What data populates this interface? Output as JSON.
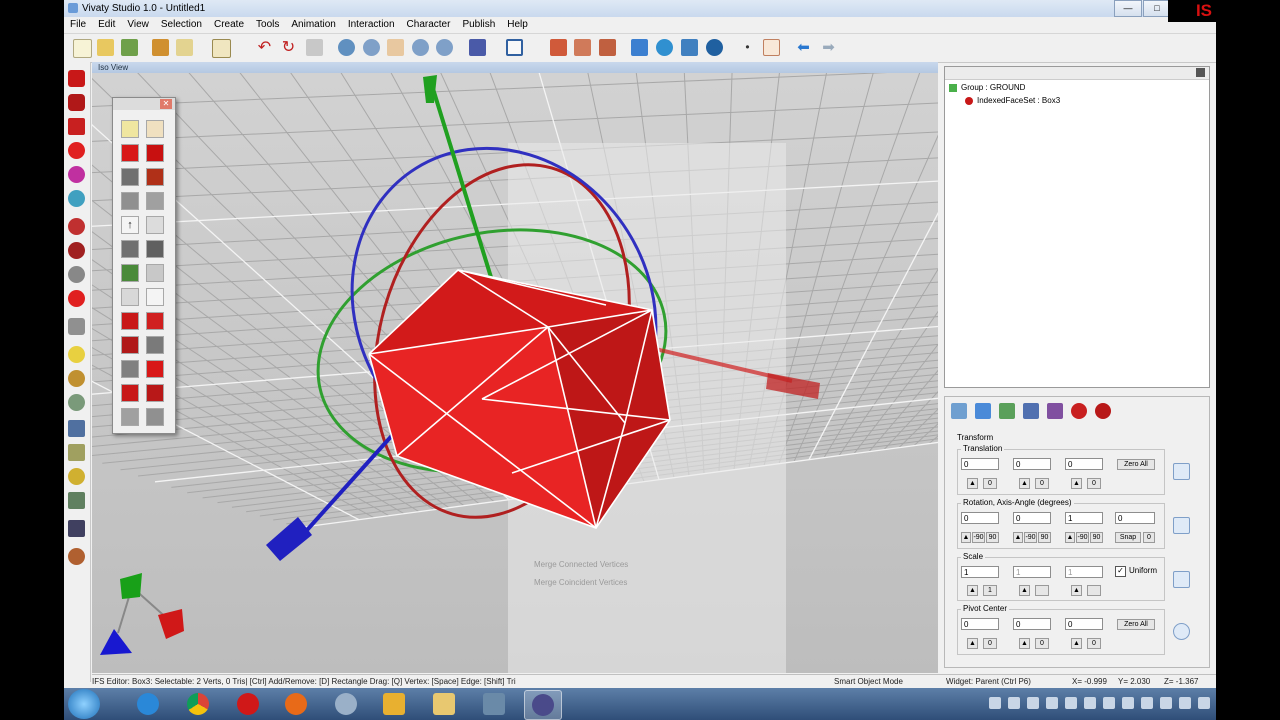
{
  "window": {
    "title": "Vivaty Studio 1.0 - Untitled1",
    "minimize": "—",
    "maximize": "□",
    "close": "✕"
  },
  "corner_badge": "IS",
  "menu": [
    "File",
    "Edit",
    "View",
    "Selection",
    "Create",
    "Tools",
    "Animation",
    "Interaction",
    "Character",
    "Publish",
    "Help"
  ],
  "viewport": {
    "title": "Iso View"
  },
  "scene_tree": {
    "group": "Group : GROUND",
    "child": "IndexedFaceSet : Box3"
  },
  "properties": {
    "transform_label": "Transform",
    "translation": {
      "label": "Translation",
      "x": "0",
      "y": "0",
      "z": "0",
      "zero_all": "Zero All",
      "step": "0"
    },
    "rotation": {
      "label": "Rotation, Axis-Angle (degrees)",
      "x": "0",
      "y": "0",
      "z": "1",
      "angle": "0",
      "neg90": "-90",
      "pos90": "90",
      "snap": "Snap",
      "snap_val": "0"
    },
    "scale": {
      "label": "Scale",
      "x": "1",
      "y": "1",
      "z": "1",
      "uniform": "Uniform",
      "uniform_checked": true,
      "step": "1"
    },
    "pivot": {
      "label": "Pivot Center",
      "x": "0",
      "y": "0",
      "z": "0",
      "zero_all": "Zero All",
      "step": "0"
    }
  },
  "status": {
    "hint": "IFS Editor: Box3: Selectable: 2 Verts, 0 Tris| [Ctrl] Add/Remove: [D] Rectangle Drag: [Q] Vertex: [Space] Edge: [Shift] Tri",
    "mode": "Smart Object Mode",
    "widget": "Widget: Parent (Ctrl P6)",
    "x": "X= -0.999",
    "y": "Y= 2.030",
    "z": "Z= -1.367"
  },
  "context_menu_faded": [
    "Merge Connected Vertices",
    "Merge Coincident Vertices"
  ],
  "colors": {
    "box_red": "#c61515",
    "axis_green": "#20a020",
    "axis_blue": "#2020c0",
    "axis_red": "#d02020",
    "ring_blue": "#3030c0",
    "ring_red": "#b02020",
    "ring_green": "#30a030"
  }
}
